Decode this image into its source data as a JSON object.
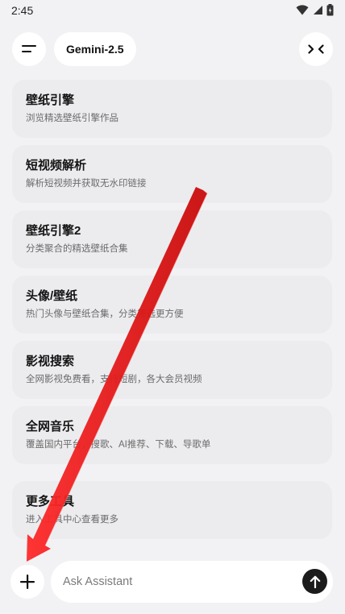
{
  "status_bar": {
    "time": "2:45",
    "icons": [
      "wifi-icon",
      "signal-icon",
      "battery-icon"
    ]
  },
  "header": {
    "menu_icon": "menu-icon",
    "model_name": "Gemini-2.5",
    "collapse_icon": "collapse-icon"
  },
  "tools": [
    {
      "title": "壁纸引擎",
      "desc": "浏览精选壁纸引擎作品"
    },
    {
      "title": "短视频解析",
      "desc": "解析短视频并获取无水印链接"
    },
    {
      "title": "壁纸引擎2",
      "desc": "分类聚合的精选壁纸合集"
    },
    {
      "title": "头像/壁纸",
      "desc": "热门头像与壁纸合集，分类筛选更方便"
    },
    {
      "title": "影视搜索",
      "desc": "全网影视免费看，支持短剧，各大会员视频"
    },
    {
      "title": "全网音乐",
      "desc": "覆盖国内平台，搜歌、AI推荐、下载、导歌单"
    },
    {
      "title": "更多工具",
      "desc": "进入工具中心查看更多"
    }
  ],
  "composer": {
    "add_icon": "plus-icon",
    "placeholder": "Ask Assistant",
    "value": "",
    "send_icon": "arrow-up-icon"
  },
  "colors": {
    "background": "#f2f2f5",
    "card": "#ececef",
    "annotation_arrow": "#e31010",
    "send_button": "#1b1b1b"
  }
}
